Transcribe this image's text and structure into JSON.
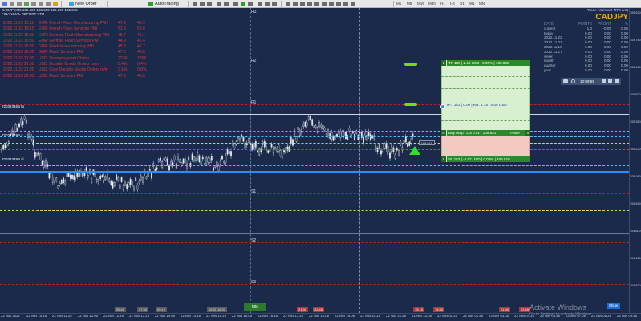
{
  "toolbar": {
    "new_order": "New Order",
    "auto_trading": "AutoTrading",
    "timeframes": [
      "M1",
      "M5",
      "M15",
      "M30",
      "H1",
      "H4",
      "D1",
      "W1",
      "MN"
    ]
  },
  "chart_info": {
    "line1": "CADJPY,M5  105.629 105.650 105.606 105.615",
    "line2": "FINANCIAL REPORT YTD"
  },
  "news": [
    {
      "date": "2022.11.23 15:15",
      "name": "EUR: French Flash Manufacturing PMI",
      "actual": "47.4",
      "forecast": "49.9"
    },
    {
      "date": "2022.11.23 15:15",
      "name": "EUR: French Flash Services PMI",
      "actual": "51.3",
      "forecast": "50.6"
    },
    {
      "date": "2022.11.23 15:30",
      "name": "EUR: German Flash Manufacturing PMI",
      "actual": "45.7",
      "forecast": "45.1"
    },
    {
      "date": "2022.11.23 15:30",
      "name": "EUR: German Flash Services PMI",
      "actual": "44.9",
      "forecast": "46.4"
    },
    {
      "date": "2022.11.23 16:30",
      "name": "GBP: Flash Manufacturing PMI",
      "actual": "45.8",
      "forecast": "45.7"
    },
    {
      "date": "2022.11.23 16:30",
      "name": "GBP: Flash Services PMI",
      "actual": "47.5",
      "forecast": "48.0"
    },
    {
      "date": "2022.11.23 21:30",
      "name": "USD: Unemployment Claims",
      "actual": "222K",
      "forecast": "225K"
    },
    {
      "date": "2022.11.23 21:30",
      "name": "USD: Durable Goods Orders m/m",
      "actual": "0.4%",
      "forecast": "0.4%"
    },
    {
      "date": "2022.11.23 21:30",
      "name": "USD: Core Durable Goods Orders m/m",
      "actual": "0.1%",
      "forecast": "0.0%"
    },
    {
      "date": "2022.11.23 22:45",
      "name": "USD: Flash Services PMI",
      "actual": "47.9",
      "forecast": "46.0"
    }
  ],
  "pivots": {
    "r3": "R3",
    "r2": "R2",
    "r1": "R1",
    "pp": "PP",
    "s1": "S1",
    "s2": "S2",
    "s3": "S3"
  },
  "order_tags": {
    "tag1": "#2032346B tp",
    "tag2": "#2032349B s",
    "tag3": "#2032349B sl"
  },
  "trade_panel": {
    "tp_bar": "TP 139 | 2.45 USD | 0.00% | 105.868",
    "tp1": "TP1 141 | 0.00 | RR: 1.15 | 0.00 USD",
    "entry_bar": "Buy Stop | Lot 0.01 | 105.641",
    "place": "Place",
    "sl_bar": "SL 123 | -2.87 USD | 0.00% | 105.518",
    "left_tp": "L",
    "left_entry": "R",
    "left_sl": "L",
    "right_x": "X"
  },
  "assistant": {
    "brand": "Trade Assistant MT4 (v1)",
    "symbol": "CADJPY",
    "columns": [
      "DATE",
      "POINTS",
      "PROFIT",
      "%"
    ],
    "rows": [
      {
        "label": "current",
        "points": "1.0",
        "profit": "-0.05",
        "pct": "0.00"
      },
      {
        "label": "today",
        "points": "0.00",
        "profit": "0.00",
        "pct": "0.00"
      },
      {
        "label": "2022.11.22",
        "points": "0.00",
        "profit": "0.00",
        "pct": "0.00"
      },
      {
        "label": "2022.11.21",
        "points": "0.00",
        "profit": "0.00",
        "pct": "0.00"
      },
      {
        "label": "2022.11.18",
        "points": "0.00",
        "profit": "0.00",
        "pct": "0.00"
      },
      {
        "label": "2022.11.17",
        "points": "0.00",
        "profit": "0.00",
        "pct": "0.00"
      },
      {
        "label": "week",
        "points": "0.00",
        "profit": "0.00",
        "pct": "0.00"
      },
      {
        "label": "month",
        "points": "0.00",
        "profit": "0.00",
        "pct": "0.00"
      },
      {
        "label": "quarter",
        "points": "0.00",
        "profit": "0.00",
        "pct": "0.00"
      },
      {
        "label": "year",
        "points": "0.00",
        "profit": "0.00",
        "pct": "0.00"
      }
    ],
    "clock": "10:09:55"
  },
  "price_axis": [
    "105.920",
    "105.780",
    "105.640",
    "105.500",
    "105.360",
    "105.220",
    "105.080",
    "104.940",
    "104.800",
    "104.660",
    "104.520"
  ],
  "time_axis": [
    "22 Nov 2022",
    "22 Nov 10:45",
    "22 Nov 11:25",
    "22 Nov 12:05",
    "22 Nov 12:45",
    "22 Nov 13:25",
    "22 Nov 14:05",
    "22 Nov 14:45",
    "22 Nov 15:25",
    "22 Nov 16:05",
    "22 Nov 16:45",
    "22 Nov 17:25",
    "22 Nov 18:05",
    "22 Nov 19:05",
    "22 Nov 20:25",
    "22 Nov 21:45",
    "22 Nov 23:05",
    "23 Nov 00:25",
    "23 Nov 01:45",
    "23 Nov 03:05",
    "23 Nov 04:25",
    "23 Nov 05:45",
    "23 Nov 07:05",
    "23 Nov 08:25",
    "23 Nov 09:45"
  ],
  "bottom": {
    "mm": "MM",
    "show": "Show",
    "activate": "Activate Windows",
    "activate_sub": "Go to Settings to activate Windows."
  },
  "colors": {
    "background": "#1b2a4a",
    "pivot_line": "#c81e1e",
    "tp_zone": "#d9f0d0",
    "sl_zone": "#f3c9c2",
    "panel_bar": "#2c8a2c",
    "symbol": "#f0a500"
  }
}
